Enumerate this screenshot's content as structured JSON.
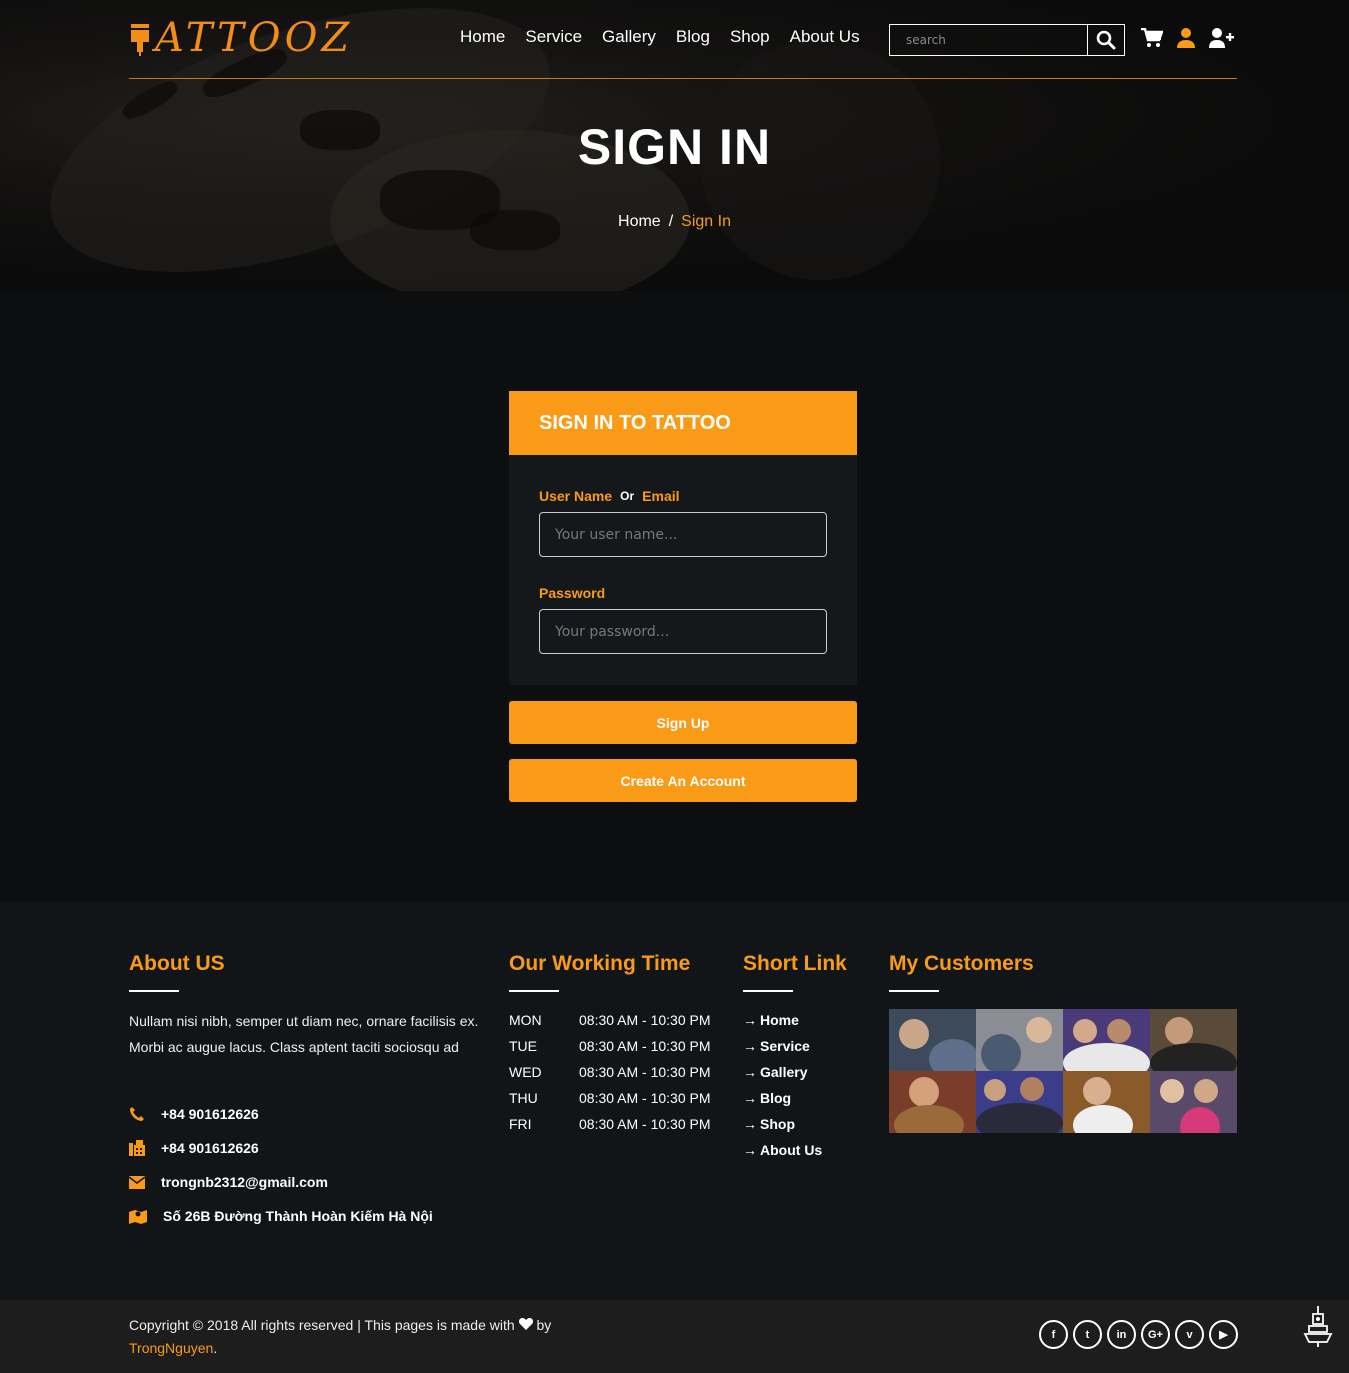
{
  "brand": {
    "logo_text": "ATTOOZ",
    "accent": "#f99b16"
  },
  "nav": {
    "items": [
      "Home",
      "Service",
      "Gallery",
      "Blog",
      "Shop",
      "About Us"
    ]
  },
  "search": {
    "placeholder": "search"
  },
  "header_icons": [
    "cart-icon",
    "user-icon",
    "user-plus-icon"
  ],
  "hero": {
    "title": "SIGN IN",
    "breadcrumb_home": "Home",
    "breadcrumb_sep": "/",
    "breadcrumb_current": "Sign In"
  },
  "signin": {
    "heading": "SIGN IN TO TATTOO",
    "username_label_a": "User Name",
    "username_label_or": "Or",
    "username_label_b": "Email",
    "username_placeholder": "Your user name...",
    "password_label": "Password",
    "password_placeholder": "Your password...",
    "signup_button": "Sign Up",
    "create_button": "Create An Account"
  },
  "footer": {
    "about": {
      "title": "About US",
      "text": "Nullam nisi nibh, semper ut diam nec, ornare facilisis ex. Morbi ac augue lacus. Class aptent taciti sociosqu ad",
      "phone": "+84 901612626",
      "fax": "+84 901612626",
      "email": "trongnb2312@gmail.com",
      "address": "Số 26B Đường Thành Hoàn Kiếm Hà Nội"
    },
    "hours": {
      "title": "Our Working Time",
      "rows": [
        {
          "day": "MON",
          "time": "08:30 AM - 10:30 PM"
        },
        {
          "day": "TUE",
          "time": "08:30 AM - 10:30 PM"
        },
        {
          "day": "WED",
          "time": "08:30 AM - 10:30 PM"
        },
        {
          "day": "THU",
          "time": "08:30 AM - 10:30 PM"
        },
        {
          "day": "FRI",
          "time": "08:30 AM - 10:30 PM"
        }
      ]
    },
    "links": {
      "title": "Short Link",
      "items": [
        "Home",
        "Service",
        "Gallery",
        "Blog",
        "Shop",
        "About Us"
      ]
    },
    "customers": {
      "title": "My Customers"
    }
  },
  "bottom": {
    "copyright_a": "Copyright © 2018 All rights reserved | This pages is made with",
    "copyright_by": "by",
    "author": "TrongNguyen",
    "period": ".",
    "social": [
      "facebook-icon",
      "twitter-icon",
      "linkedin-icon",
      "google-plus-icon",
      "vimeo-icon",
      "youtube-icon"
    ]
  }
}
